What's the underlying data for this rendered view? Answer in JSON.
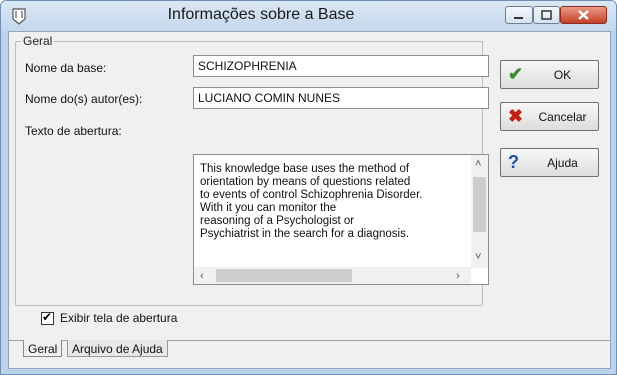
{
  "window": {
    "title": "Informações sobre a Base"
  },
  "general_group": {
    "legend": "Geral",
    "base_name_label": "Nome da base:",
    "base_name_value": "SCHIZOPHRENIA",
    "authors_label": "Nome do(s) autor(es):",
    "authors_value": "LUCIANO COMIN NUNES",
    "opening_text_label": "Texto de abertura:",
    "opening_text": "This knowledge base uses the method of\norientation by means of questions related\nto events of control  Schizophrenia Disorder.\nWith it you can monitor the\nreasoning of a Psychologist or\nPsychiatrist in the search for a diagnosis.",
    "show_opening_label": "Exibir tela de abertura",
    "show_opening_checked": true
  },
  "buttons": {
    "ok": "OK",
    "cancel": "Cancelar",
    "help": "Ajuda"
  },
  "tabs": [
    {
      "label": "Geral"
    },
    {
      "label": "Arquivo de Ajuda"
    }
  ],
  "icons": {
    "ok": "check-icon",
    "cancel": "x-icon",
    "help": "question-icon",
    "app": "app-icon"
  },
  "colors": {
    "ok_icon": "#3f8a2e",
    "cancel_icon": "#c0221a",
    "help_icon": "#1f4fa8",
    "close_button": "#c4412a"
  }
}
